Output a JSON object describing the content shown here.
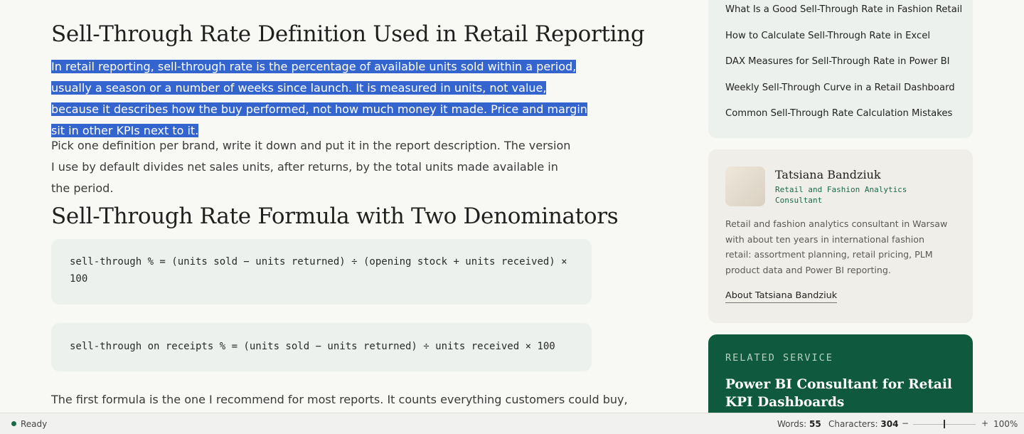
{
  "article": {
    "heading1": "Sell-Through Rate Definition Used in Retail Reporting",
    "selected_paragraph": "In retail reporting, sell-through rate is the percentage of available units sold within a period, usually a season or a number of weeks since launch. It is measured in units, not value, because it describes how the buy performed, not how much money it made. Price and margin sit in other KPIs next to it.",
    "paragraph2": "Pick one definition per brand, write it down and put it in the report description. The version I use by default divides net sales units, after returns, by the total units made available in the period.",
    "heading2": "Sell-Through Rate Formula with Two Denominators",
    "code1": "sell-through % = (units sold − units returned) ÷ (opening stock + units received) × 100",
    "code2": "sell-through on receipts % = (units sold − units returned) ÷ units received × 100",
    "paragraph3": "The first formula is the one I recommend for most reports. It counts everything customers could buy,"
  },
  "sidebar": {
    "toc": [
      "What Is a Good Sell-Through Rate in Fashion Retail",
      "How to Calculate Sell-Through Rate in Excel",
      "DAX Measures for Sell-Through Rate in Power BI",
      "Weekly Sell-Through Curve in a Retail Dashboard",
      "Common Sell-Through Rate Calculation Mistakes"
    ],
    "author": {
      "name": "Tatsiana Bandziuk",
      "role": "Retail and Fashion Analytics Consultant",
      "bio": "Retail and fashion analytics consultant in Warsaw with about ten years in international fashion retail: assortment planning, retail pricing, PLM product data and Power BI reporting.",
      "link": "About Tatsiana Bandziuk"
    },
    "service": {
      "eyebrow": "RELATED SERVICE",
      "title": "Power BI Consultant for Retail KPI Dashboards"
    }
  },
  "statusbar": {
    "status": "Ready",
    "words_label": "Words:",
    "words_value": "55",
    "chars_label": "Characters:",
    "chars_value": "304",
    "zoom_minus": "−",
    "zoom_plus": "+",
    "zoom_level": "100%",
    "zoom_fraction": 0.5,
    "accent_color": "#1b6a45",
    "selection_color": "#3465cf"
  }
}
